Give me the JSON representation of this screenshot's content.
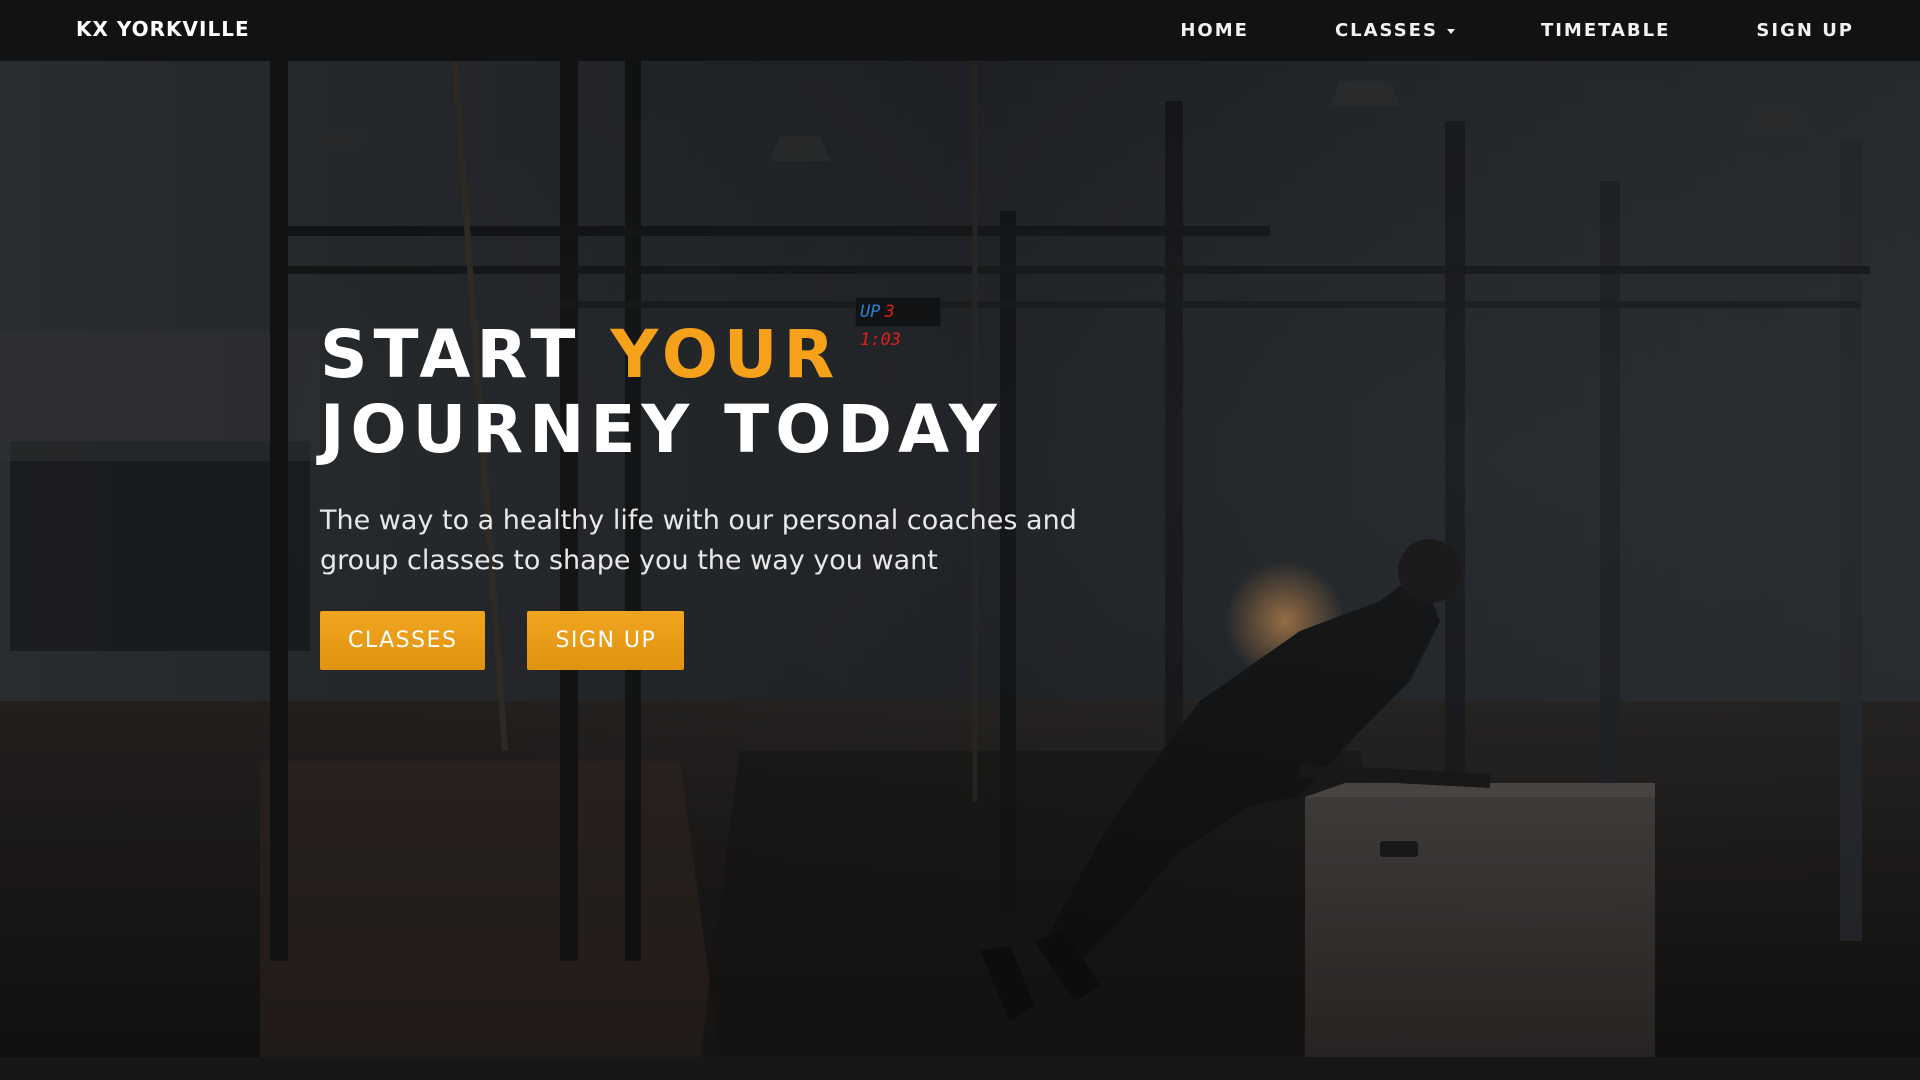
{
  "brand": {
    "name": "KX YORKVILLE"
  },
  "nav": {
    "items": [
      {
        "label": "HOME"
      },
      {
        "label": "CLASSES"
      },
      {
        "label": "TIMETABLE"
      },
      {
        "label": "SIGN UP"
      }
    ]
  },
  "hero": {
    "headline_start": "START",
    "headline_accent": "YOUR",
    "headline_end": "JOURNEY TODAY",
    "subtext": "The way to a healthy life with our personal coaches and group classes to shape you the way you want",
    "buttons": [
      {
        "label": "CLASSES"
      },
      {
        "label": "SIGN UP"
      }
    ],
    "timer": {
      "prefix": "UP",
      "value": "3 1:03"
    }
  },
  "colors": {
    "accent": "#f6a11a",
    "button": "#e79a14",
    "navbar": "#111213"
  },
  "icons": {
    "dropdown": "caret-down-icon"
  }
}
